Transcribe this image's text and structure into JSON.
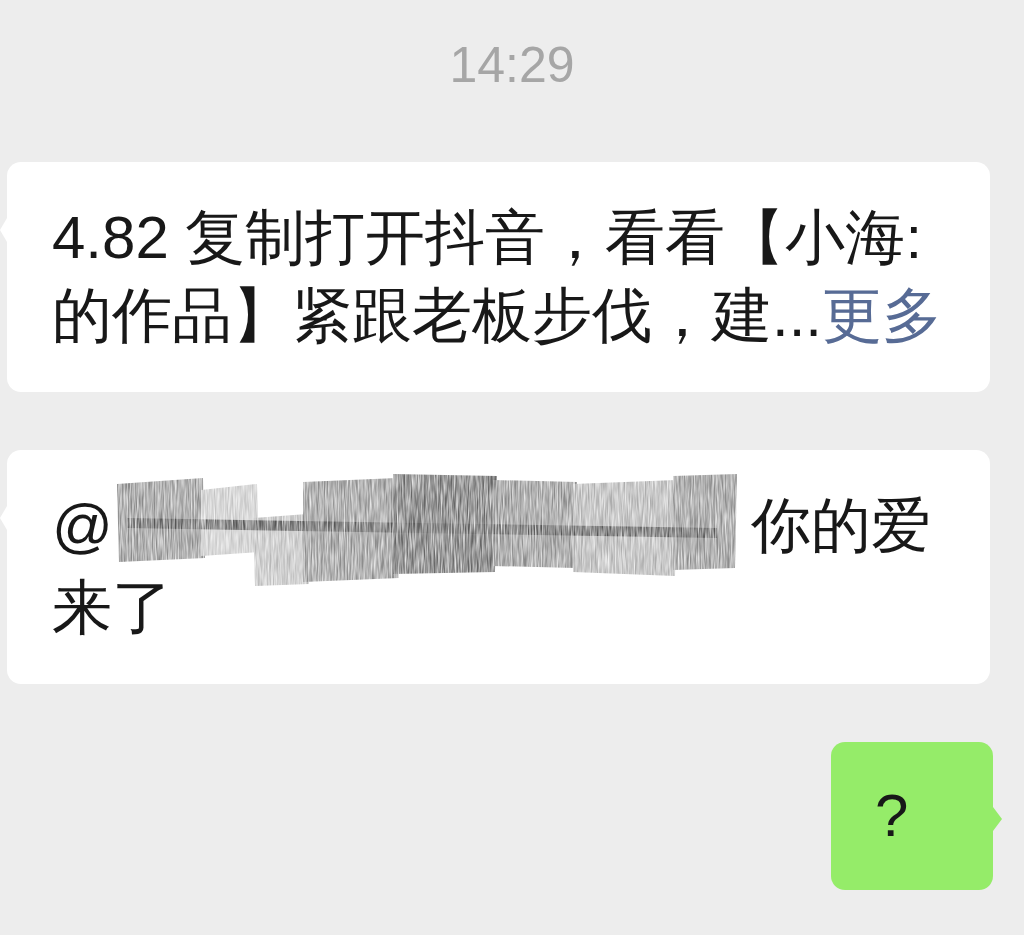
{
  "timestamp": "14:29",
  "messages": [
    {
      "kind": "received",
      "parts": [
        {
          "kind": "text",
          "text": "4.82 复制打开抖音，看看【小海:的作品】紧跟老板步伐，建..."
        },
        {
          "kind": "link",
          "text": "更多"
        }
      ]
    },
    {
      "kind": "received",
      "parts": [
        {
          "kind": "text",
          "text": "@"
        },
        {
          "kind": "redaction"
        },
        {
          "kind": "text",
          "text": "你的爱"
        },
        {
          "kind": "text",
          "text": "来了"
        }
      ]
    },
    {
      "kind": "sent",
      "parts": [
        {
          "kind": "text",
          "text": "?"
        }
      ]
    }
  ]
}
